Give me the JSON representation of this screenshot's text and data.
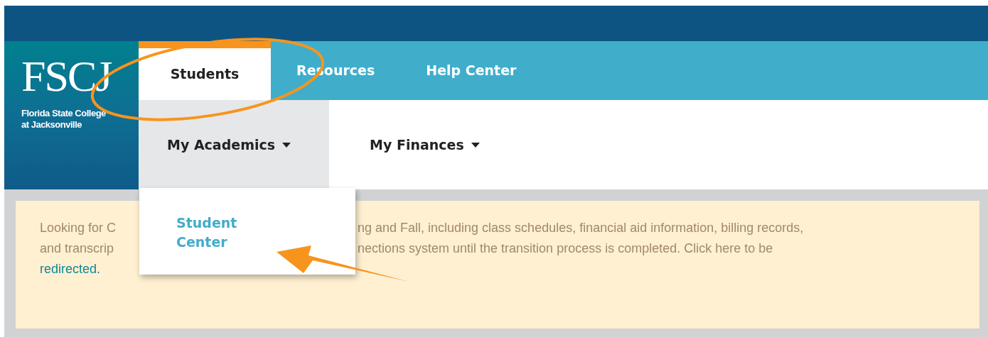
{
  "logo": {
    "wordmark": "FSCJ",
    "name_lines": [
      "Florida State College",
      "at Jacksonville"
    ]
  },
  "tabs": [
    {
      "label": "Students",
      "selected": true
    },
    {
      "label": "Resources",
      "selected": false
    },
    {
      "label": "Help Center",
      "selected": false
    }
  ],
  "subnav": [
    {
      "label": "My Academics",
      "expanded": true
    },
    {
      "label": "My Finances",
      "expanded": false
    }
  ],
  "dropdown": {
    "items": [
      "Student Center"
    ]
  },
  "notice": {
    "left": [
      "Looking for C",
      "and transcrip"
    ],
    "right": [
      "ng and Fall, including class schedules, financial aid information, billing records,",
      "nections system until the transition process is completed. Click here to be"
    ],
    "link": "redirected."
  }
}
